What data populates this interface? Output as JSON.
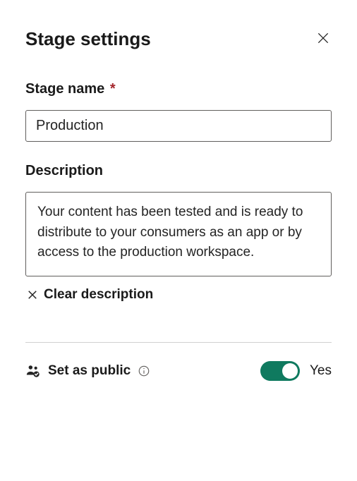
{
  "title": "Stage settings",
  "stage_name": {
    "label": "Stage name",
    "value": "Production"
  },
  "description": {
    "label": "Description",
    "value": "Your content has been tested and is ready to distribute to your consumers as an app or by access to the production workspace.",
    "clear_label": "Clear description"
  },
  "public": {
    "label": "Set as public",
    "state_label": "Yes",
    "toggle_color": "#0f7a5f"
  }
}
